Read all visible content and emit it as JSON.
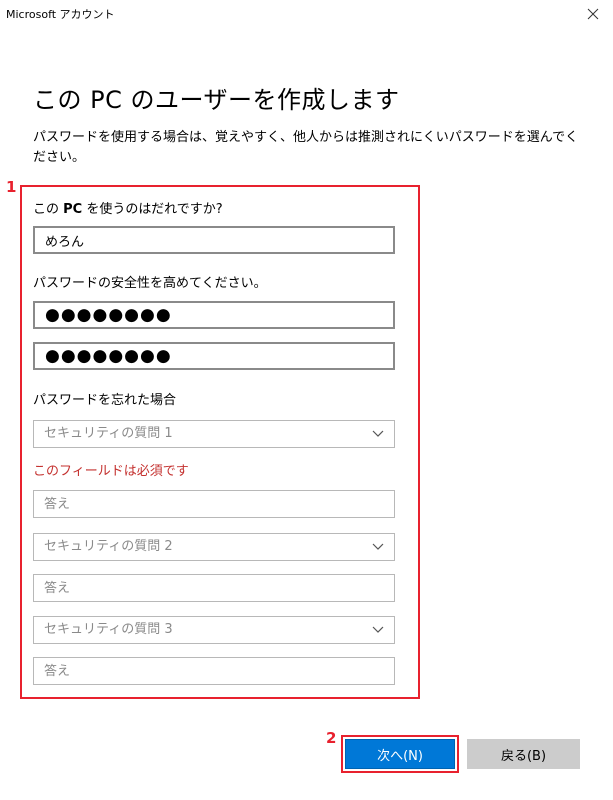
{
  "window": {
    "title": "Microsoft アカウント"
  },
  "page": {
    "heading": "この PC のユーザーを作成します",
    "description": "パスワードを使用する場合は、覚えやすく、他人からは推測されにくいパスワードを選んでください。"
  },
  "form": {
    "who_label_prefix": "この ",
    "who_label_bold": "PC",
    "who_label_suffix": " を使うのはだれですか?",
    "username_value": "めろん",
    "password_label": "パスワードの安全性を高めてください。",
    "password_mask": "●●●●●●●●",
    "password_confirm_mask": "●●●●●●●●",
    "forgot_label": "パスワードを忘れた場合",
    "security_questions": [
      {
        "select_label": "セキュリティの質問 1",
        "answer_placeholder": "答え"
      },
      {
        "select_label": "セキュリティの質問 2",
        "answer_placeholder": "答え"
      },
      {
        "select_label": "セキュリティの質問 3",
        "answer_placeholder": "答え"
      }
    ],
    "required_error": "このフィールドは必須です"
  },
  "buttons": {
    "next_label": "次へ(N)",
    "back_label": "戻る(B)"
  },
  "annotations": {
    "box_number": "1",
    "button_number": "2",
    "highlight_color": "#e8212e"
  },
  "colors": {
    "accent": "#0078d7",
    "error": "#c4312f",
    "secondary_button": "#cccccc"
  }
}
